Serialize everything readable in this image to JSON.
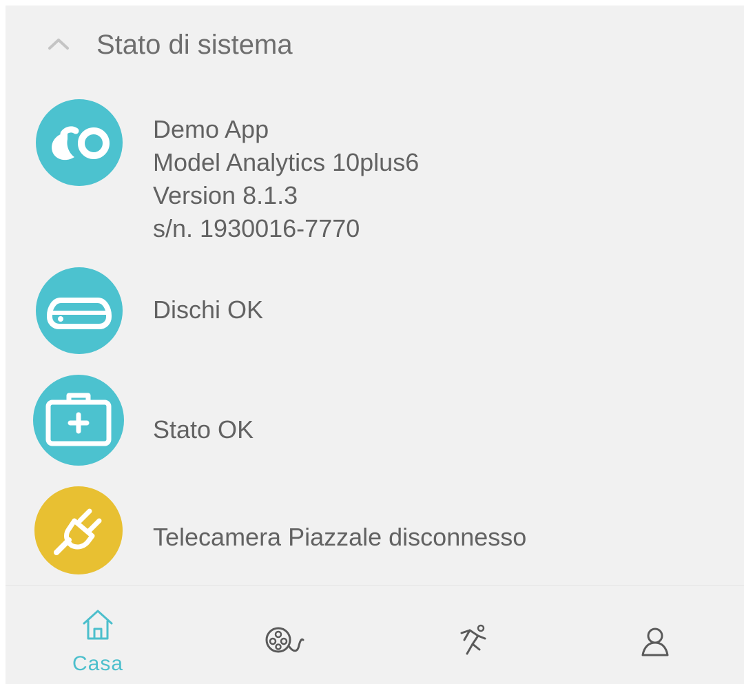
{
  "colors": {
    "accent": "#4cc2cf",
    "warning": "#e8c032",
    "panel_bg": "#f1f1f1",
    "text": "#626262",
    "nav_active": "#4cbfcc",
    "nav_inactive": "#5a5a5a"
  },
  "section": {
    "title": "Stato di sistema",
    "expanded": true,
    "chevron_icon": "chevron-up-icon"
  },
  "status_items": [
    {
      "icon": "app-logo-icon",
      "color": "#4cc2cf",
      "lines": [
        "Demo App",
        "Model Analytics 10plus6",
        "Version 8.1.3",
        "s/n. 1930016-7770"
      ]
    },
    {
      "icon": "hard-disk-icon",
      "color": "#4cc2cf",
      "lines": [
        "Dischi OK"
      ]
    },
    {
      "icon": "first-aid-kit-icon",
      "color": "#4cc2cf",
      "lines": [
        "Stato OK"
      ]
    },
    {
      "icon": "unplugged-icon",
      "color": "#e8c032",
      "lines": [
        "Telecamera Piazzale disconnesso"
      ]
    }
  ],
  "bottom_nav": {
    "active": "home",
    "items": [
      {
        "id": "home",
        "icon": "home-icon",
        "label": "Casa"
      },
      {
        "id": "recordings",
        "icon": "film-reel-icon",
        "label": ""
      },
      {
        "id": "motion",
        "icon": "running-person-icon",
        "label": ""
      },
      {
        "id": "account",
        "icon": "user-icon",
        "label": ""
      }
    ]
  }
}
